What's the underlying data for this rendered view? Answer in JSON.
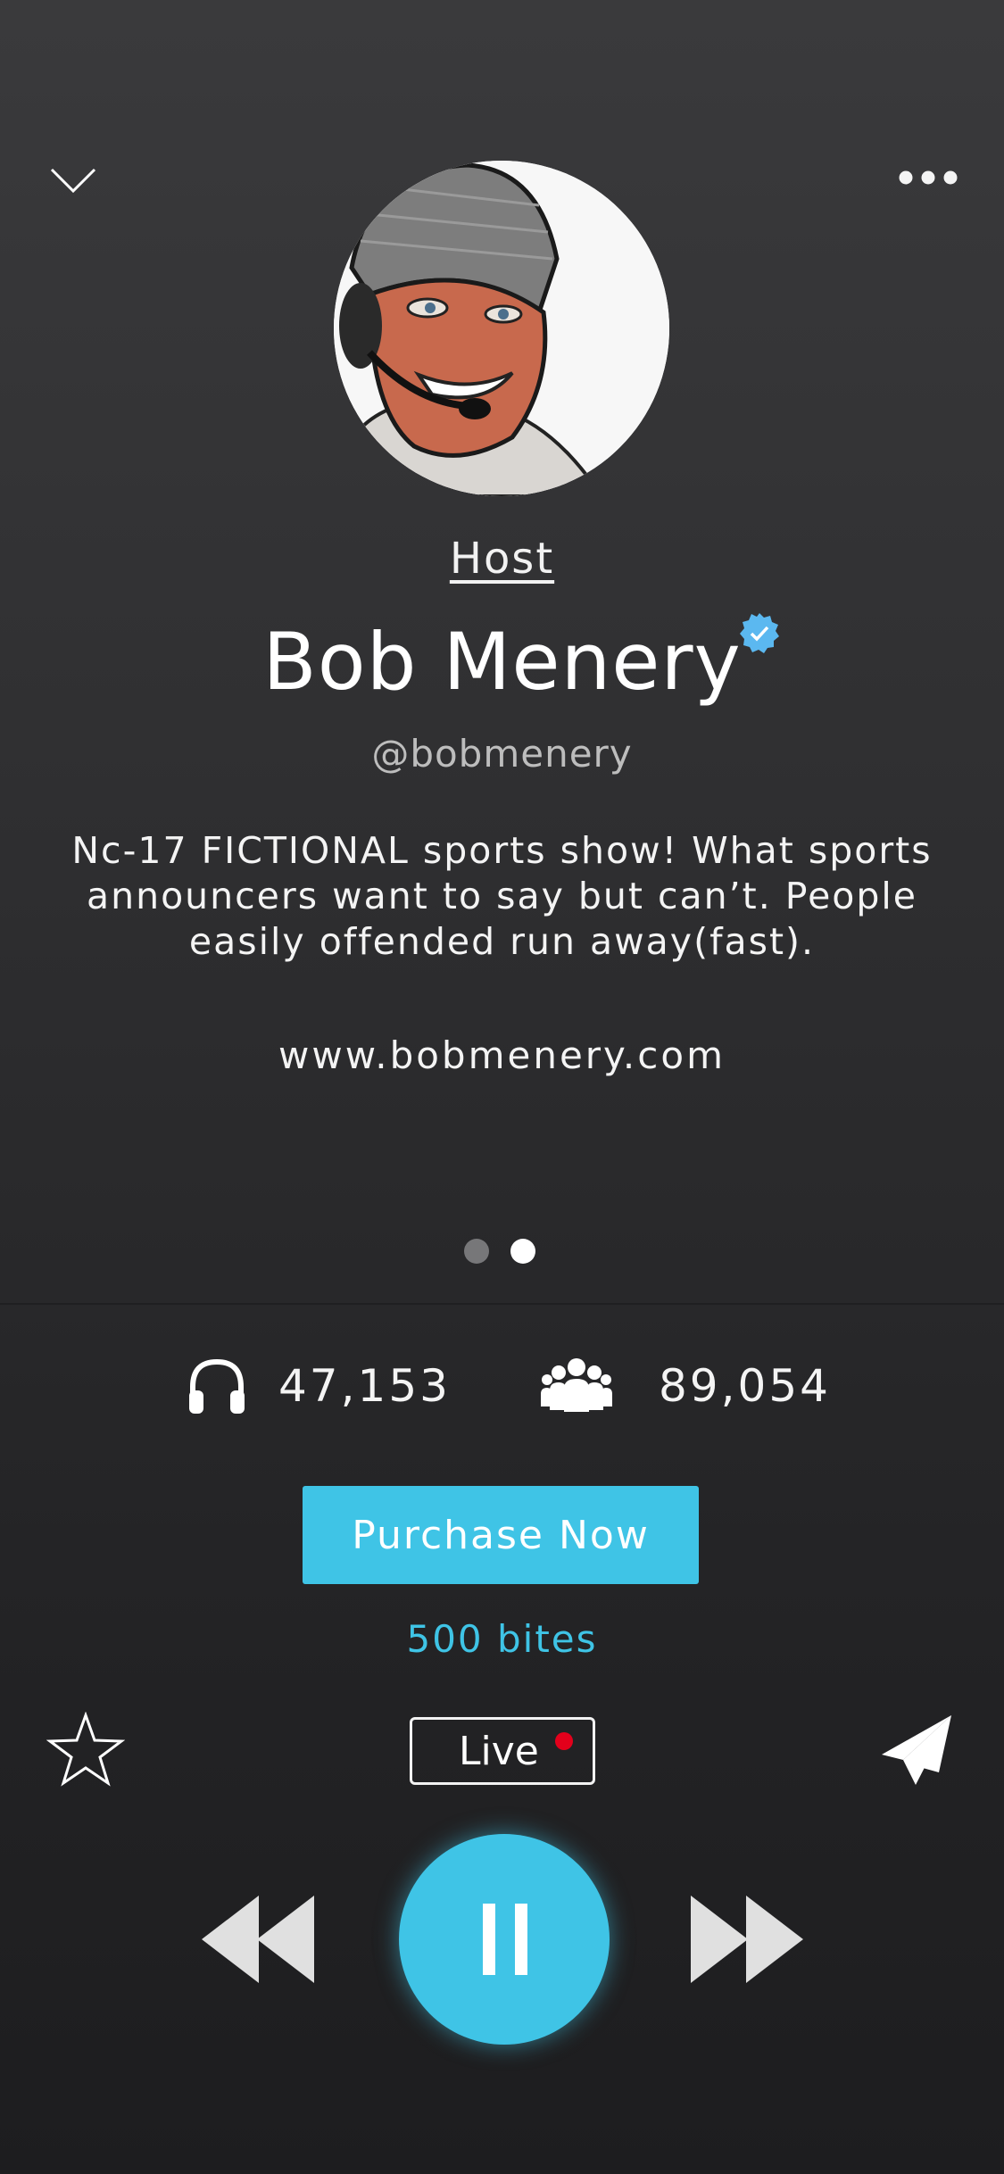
{
  "header": {
    "collapse_icon": "chevron-down-icon",
    "more_icon": "more-horizontal-icon"
  },
  "profile": {
    "role_label": "Host",
    "name": "Bob Menery",
    "verified_icon": "verified-badge-icon",
    "handle": "@bobmenery",
    "bio": "Nc-17 FICTIONAL sports show! What sports announcers want to say but can’t. People easily offended run away(fast).",
    "website": "www.bobmenery.com"
  },
  "pager": {
    "total_pages": 2,
    "active_page": 2
  },
  "stats": {
    "listeners_icon": "headphones-icon",
    "listeners": "47,153",
    "followers_icon": "group-icon",
    "followers": "89,054"
  },
  "purchase": {
    "button_label": "Purchase Now",
    "price": "500 bites"
  },
  "actions": {
    "favorite_icon": "star-icon",
    "live_label": "Live",
    "share_icon": "paper-plane-icon"
  },
  "player": {
    "rewind_icon": "rewind-icon",
    "play_state_icon": "pause-icon",
    "forward_icon": "fast-forward-icon"
  },
  "colors": {
    "accent": "#3fc4e6",
    "live_dot": "#e3001b",
    "verified": "#5bb8f0",
    "background_top": "#3a3a3c",
    "background_bottom": "#1d1d1f"
  }
}
